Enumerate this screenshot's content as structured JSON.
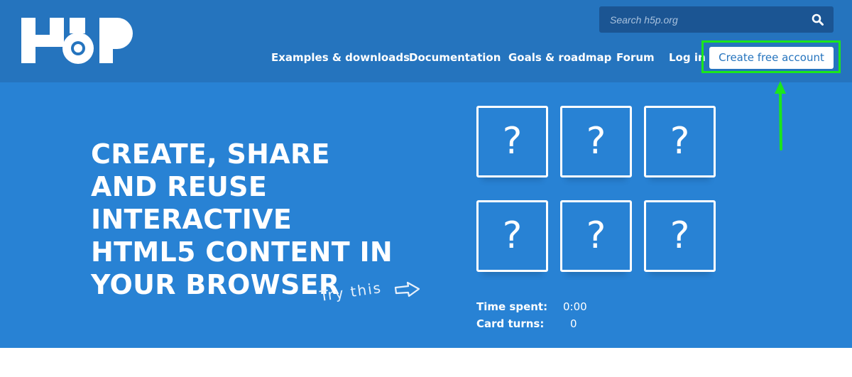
{
  "header": {
    "logo_text": "H5P",
    "search": {
      "placeholder": "Search h5p.org",
      "icon": "search-icon"
    },
    "nav": [
      "Examples & downloads",
      "Documentation",
      "Goals & roadmap",
      "Forum",
      "Log in"
    ],
    "cta": "Create free account"
  },
  "hero": {
    "title": "CREATE, SHARE AND REUSE INTERACTIVE HTML5 CONTENT IN YOUR BROWSER",
    "try_this": "Try this",
    "cards": [
      "?",
      "?",
      "?",
      "?",
      "?",
      "?"
    ],
    "stats": {
      "time_label": "Time spent:",
      "time_value": "0:00",
      "turns_label": "Card turns:",
      "turns_value": "0"
    }
  },
  "colors": {
    "header": "#2574be",
    "hero": "#2882d4",
    "highlight": "#1be61b"
  }
}
